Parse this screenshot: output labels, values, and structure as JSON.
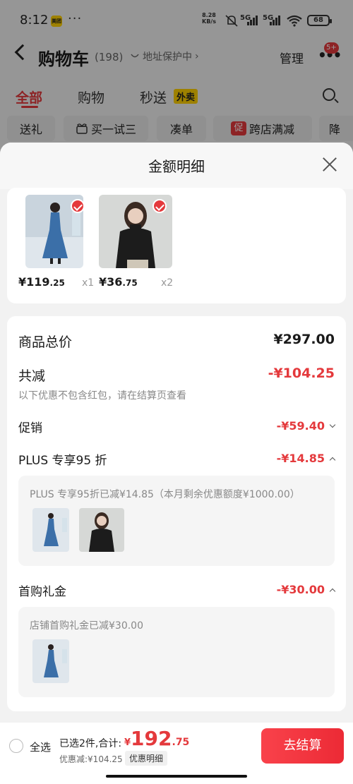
{
  "status_bar": {
    "time": "8:12",
    "app_badge": "美团",
    "more": "···",
    "net_speed_value": "8.28",
    "net_speed_unit": "KB/s",
    "sig1": "5G",
    "sig2": "5G",
    "battery": "68"
  },
  "header": {
    "title": "购物车",
    "count": "(198)",
    "address_protect": "地址保护中",
    "chevron": "›",
    "manage": "管理",
    "more_dots": "•••",
    "badge": "5+"
  },
  "tabs": [
    {
      "label": "全部",
      "active": true
    },
    {
      "label": "购物"
    },
    {
      "label": "秒送"
    }
  ],
  "waimai_tag": "外卖",
  "chips": [
    "送礼",
    "买一试三",
    "凑单",
    "跨店满减",
    "降"
  ],
  "chip_promo_icon": "促",
  "sheet": {
    "title": "金额明细",
    "products": [
      {
        "price_int": "¥119",
        "price_dec": ".25",
        "qty": "x1"
      },
      {
        "price_int": "¥36",
        "price_dec": ".75",
        "qty": "x2"
      }
    ],
    "total_label": "商品总价",
    "total_value": "¥297.00",
    "reduce_label": "共减",
    "reduce_value": "-¥104.25",
    "reduce_note": "以下优惠不包含红包，请在结算页查看",
    "promo_label": "促销",
    "promo_value": "-¥59.40",
    "plus_label": "PLUS 专享95 折",
    "plus_value": "-¥14.85",
    "plus_note": "PLUS 专享95折已减¥14.85（本月剩余优惠额度¥1000.00）",
    "gift_label": "首购礼金",
    "gift_value": "-¥30.00",
    "gift_note": "店铺首购礼金已减¥30.00"
  },
  "bottom_bar": {
    "select_all": "全选",
    "selected_info": "已选2件,合计:",
    "currency": "¥",
    "total_int": "192",
    "total_dec": ".75",
    "discount": "优惠减:¥104.25",
    "detail_button": "优惠明细",
    "checkout": "去结算"
  }
}
